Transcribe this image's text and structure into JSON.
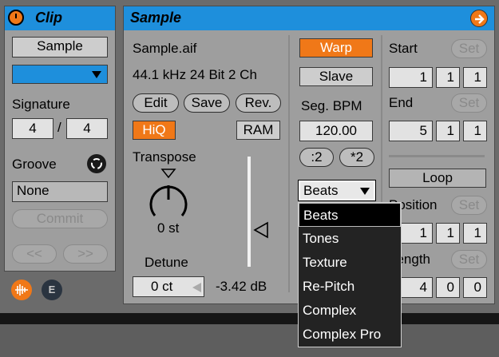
{
  "clip": {
    "title": "Clip",
    "sample_button": "Sample",
    "signature_label": "Signature",
    "sig_num": "4",
    "sig_sep": "/",
    "sig_den": "4",
    "groove_label": "Groove",
    "groove_value": "None",
    "commit_label": "Commit",
    "nudge_back": "<<",
    "nudge_fwd": ">>",
    "color_swatch": "#1e8fdc",
    "e_badge": "E"
  },
  "sample": {
    "title": "Sample",
    "file_name": "Sample.aif",
    "file_info": "44.1 kHz 24 Bit 2 Ch",
    "edit": "Edit",
    "save": "Save",
    "rev": "Rev.",
    "hiq": "HiQ",
    "ram": "RAM",
    "transpose_label": "Transpose",
    "transpose_value": "0 st",
    "detune_label": "Detune",
    "detune_value": "0 ct",
    "gain_value": "-3.42 dB",
    "warp": "Warp",
    "slave": "Slave",
    "seg_bpm_label": "Seg. BPM",
    "seg_bpm_value": "120.00",
    "half": ":2",
    "double": "*2",
    "warp_mode": "Beats",
    "start_label": "Start",
    "end_label": "End",
    "set": "Set",
    "start": [
      "1",
      "1",
      "1"
    ],
    "end": [
      "5",
      "1",
      "1"
    ],
    "loop": "Loop",
    "position_label": "Position",
    "position": [
      "1",
      "1",
      "1"
    ],
    "length_label": "Length",
    "length": [
      "4",
      "0",
      "0"
    ]
  },
  "warp_menu": {
    "items": [
      "Beats",
      "Tones",
      "Texture",
      "Re-Pitch",
      "Complex",
      "Complex Pro"
    ],
    "selected": "Beats"
  },
  "colors": {
    "accent": "#1e8fdc",
    "orange": "#f07818",
    "panel": "#9e9e9e"
  }
}
